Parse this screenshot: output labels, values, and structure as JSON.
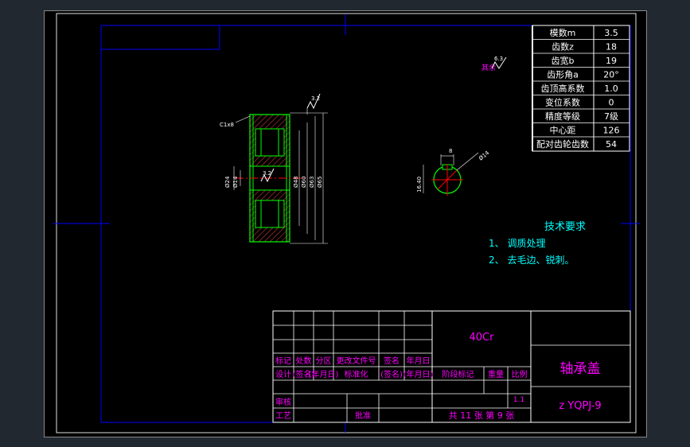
{
  "params": [
    {
      "name": "模数m",
      "value": "3.5"
    },
    {
      "name": "齿数z",
      "value": "18"
    },
    {
      "name": "齿宽b",
      "value": "19"
    },
    {
      "name": "齿形角a",
      "value": "20°"
    },
    {
      "name": "齿顶高系数",
      "value": "1.0"
    },
    {
      "name": "变位系数",
      "value": "0"
    },
    {
      "name": "精度等级",
      "value": "7级"
    },
    {
      "name": "中心距",
      "value": "126"
    },
    {
      "name": "配对齿轮齿数",
      "value": "54"
    }
  ],
  "surface_note": {
    "label": "其余",
    "value": "6.3"
  },
  "gear_dims": {
    "chamfer": "C1x8",
    "roughness_top": "3.2",
    "roughness_mid": "3.2",
    "left_dims": [
      "Ø24",
      "Ø14"
    ],
    "right_dims": [
      "Ø48",
      "Ø60",
      "Ø63",
      "Ø65"
    ]
  },
  "hub_dims": {
    "keyway_width": "8",
    "keyway_depth": "16.40",
    "dia": "Ø14"
  },
  "tech_requirements": {
    "title": "技术要求",
    "items": [
      "1、  调质处理",
      "2、  去毛边、锐刺。"
    ]
  },
  "title_block": {
    "material": "40Cr",
    "part_name": "轴承盖",
    "drawing_no": "z YQPJ-9",
    "scale": "1.1",
    "sheet": "共 11 张  第 9 张",
    "rev_headers": [
      "标记",
      "处数",
      "分区",
      "更改文件号",
      "签名",
      "年月日"
    ],
    "sign_row": [
      "设计",
      "(签名)",
      "(年月日)",
      "标准化",
      "(签名)",
      "(年月日)"
    ],
    "stage_headers": [
      "阶段标记",
      "重量",
      "比例"
    ],
    "review": "审核",
    "process": "工艺",
    "approve": "批准"
  },
  "colors": {
    "frame": "#0000ff",
    "outline": "#00ff00",
    "text_white": "#ffffff",
    "text_magenta": "#ff00ff",
    "text_cyan": "#00ffff",
    "center_line": "#ff0000",
    "hatch": "#ff4444"
  }
}
